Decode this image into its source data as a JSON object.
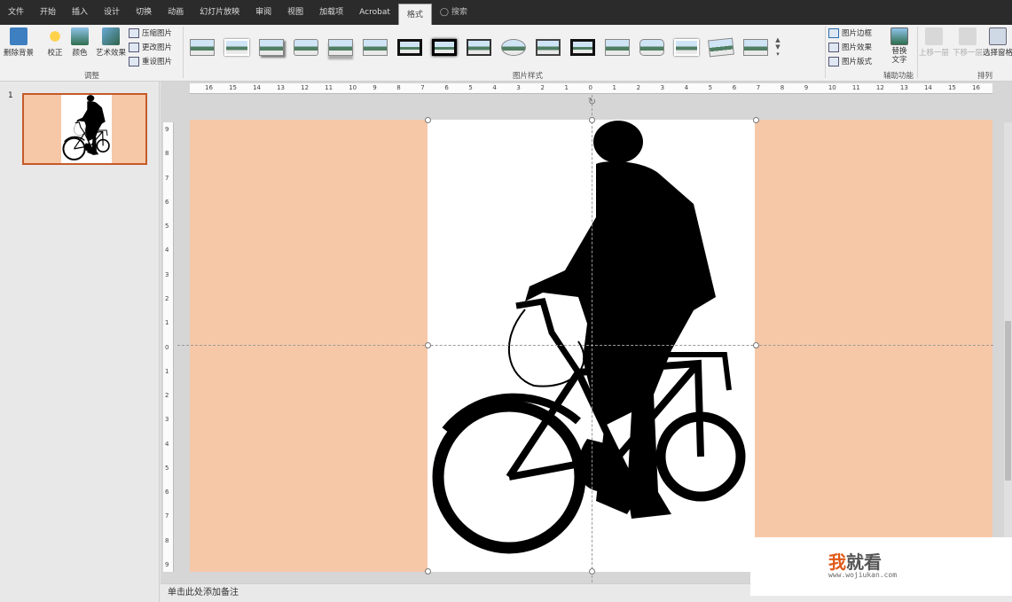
{
  "tabs": [
    "文件",
    "开始",
    "插入",
    "设计",
    "切换",
    "动画",
    "幻灯片放映",
    "审阅",
    "视图",
    "加载项",
    "Acrobat",
    "格式"
  ],
  "tell_me": "搜索",
  "ribbon": {
    "remove_bg": "删除背景",
    "correct": "校正",
    "color": "颜色",
    "art": "艺术效果",
    "compress": "压缩图片",
    "change": "更改图片",
    "reset": "重设图片",
    "group_adjust": "调整",
    "group_styles": "图片样式",
    "border": "图片边框",
    "effects": "图片效果",
    "layout": "图片版式",
    "alt_text": "替换\n文字",
    "group_access": "辅助功能",
    "bring_forward": "上移一层",
    "send_backward": "下移一层",
    "selection_pane": "选择窗格",
    "group_arrange": "排列"
  },
  "slide_number": "1",
  "ruler_h": [
    "16",
    "15",
    "14",
    "13",
    "12",
    "11",
    "10",
    "9",
    "8",
    "7",
    "6",
    "5",
    "4",
    "3",
    "2",
    "1",
    "0",
    "1",
    "2",
    "3",
    "4",
    "5",
    "6",
    "7",
    "8",
    "9",
    "10",
    "11",
    "12",
    "13",
    "14",
    "15",
    "16"
  ],
  "ruler_v": [
    "9",
    "8",
    "7",
    "6",
    "5",
    "4",
    "3",
    "2",
    "1",
    "0",
    "1",
    "2",
    "3",
    "4",
    "5",
    "6",
    "7",
    "8",
    "9"
  ],
  "notes_placeholder": "单击此处添加备注",
  "watermark": {
    "cn_first": "我",
    "cn_rest": "就看",
    "url": "www.wojiukan.com"
  },
  "colors": {
    "slide_bg": "#f7c8a8",
    "accent": "#c55a2a",
    "tabbar": "#2b2b2b"
  }
}
